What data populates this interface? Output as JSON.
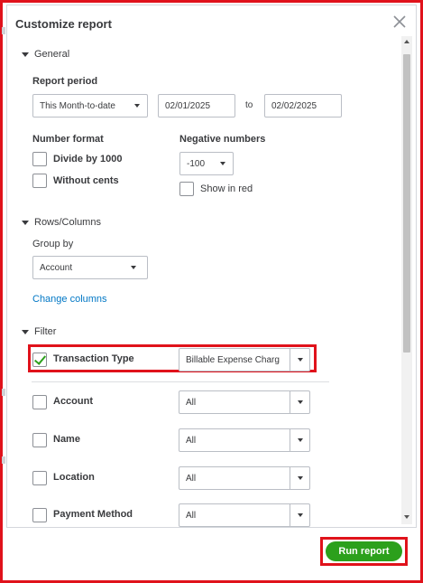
{
  "dialog": {
    "title": "Customize report"
  },
  "general": {
    "section_label": "General",
    "report_period_label": "Report period",
    "period_select": "This Month-to-date",
    "from_date": "02/01/2025",
    "to_label": "to",
    "to_date": "02/02/2025",
    "number_format_label": "Number format",
    "divide_by_1000_label": "Divide by 1000",
    "without_cents_label": "Without cents",
    "negative_numbers_label": "Negative numbers",
    "negative_select": "-100",
    "show_in_red_label": "Show in red"
  },
  "rows_columns": {
    "section_label": "Rows/Columns",
    "group_by_label": "Group by",
    "group_by_select": "Account",
    "change_columns_link": "Change columns"
  },
  "filter": {
    "section_label": "Filter",
    "rows": [
      {
        "label": "Transaction Type",
        "value": "Billable Expense Charg",
        "checked": true
      },
      {
        "label": "Account",
        "value": "All",
        "checked": false
      },
      {
        "label": "Name",
        "value": "All",
        "checked": false
      },
      {
        "label": "Location",
        "value": "All",
        "checked": false
      },
      {
        "label": "Payment Method",
        "value": "All",
        "checked": false
      }
    ]
  },
  "footer": {
    "run_report_label": "Run report"
  },
  "colors": {
    "accent_green": "#2ca01c",
    "link_blue": "#0077c5",
    "highlight_red": "#e0121b"
  }
}
